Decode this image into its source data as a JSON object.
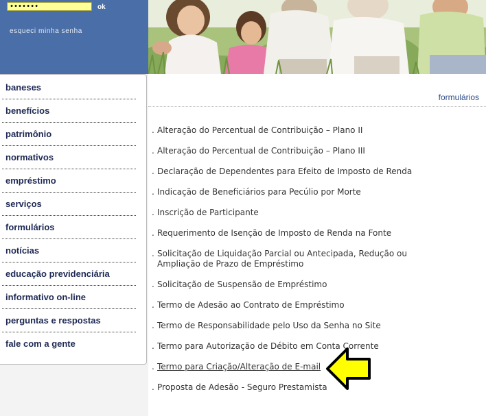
{
  "login": {
    "password_value": "•••••••",
    "ok_label": "ok",
    "forgot_label": "esqueci minha senha"
  },
  "menu": {
    "items": [
      {
        "label": "baneses"
      },
      {
        "label": "benefícios"
      },
      {
        "label": "patrimônio"
      },
      {
        "label": "normativos"
      },
      {
        "label": "empréstimo"
      },
      {
        "label": "serviços"
      },
      {
        "label": "formulários"
      },
      {
        "label": "notícias"
      },
      {
        "label": "educação previdenciária"
      },
      {
        "label": "informativo on-line"
      },
      {
        "label": "perguntas e respostas"
      },
      {
        "label": "fale com a gente"
      }
    ]
  },
  "content": {
    "section_title": "formulários",
    "bullet": ".",
    "forms": [
      {
        "label": "Alteração do Percentual de Contribuição – Plano II"
      },
      {
        "label": "Alteração do Percentual de Contribuição – Plano III"
      },
      {
        "label": "Declaração de Dependentes para Efeito de Imposto de Renda"
      },
      {
        "label": "Indicação de Beneficiários para Pecúlio por Morte"
      },
      {
        "label": "Inscrição de Participante"
      },
      {
        "label": "Requerimento de Isenção de Imposto de Renda na Fonte"
      },
      {
        "label": "Solicitação de Liquidação Parcial ou Antecipada, Redução ou Ampliação de Prazo de Empréstimo"
      },
      {
        "label": "Solicitação de Suspensão de Empréstimo"
      },
      {
        "label": "Termo de Adesão ao Contrato de Empréstimo"
      },
      {
        "label": "Termo de Responsabilidade pelo Uso da Senha no Site"
      },
      {
        "label": "Termo para Autorização de Débito em Conta Corrente"
      },
      {
        "label": "Termo para Criação/Alteração de E-mail"
      },
      {
        "label": "Proposta de Adesão - Seguro Prestamista"
      }
    ]
  },
  "colors": {
    "login_panel": "#4a6ea7",
    "password_field": "#ffff99",
    "menu_text": "#1f2a55",
    "link_text": "#333333",
    "section_title": "#2d4d8c",
    "arrow_fill": "#ffff00"
  },
  "icons": {
    "pointer": "arrow-left-icon"
  }
}
